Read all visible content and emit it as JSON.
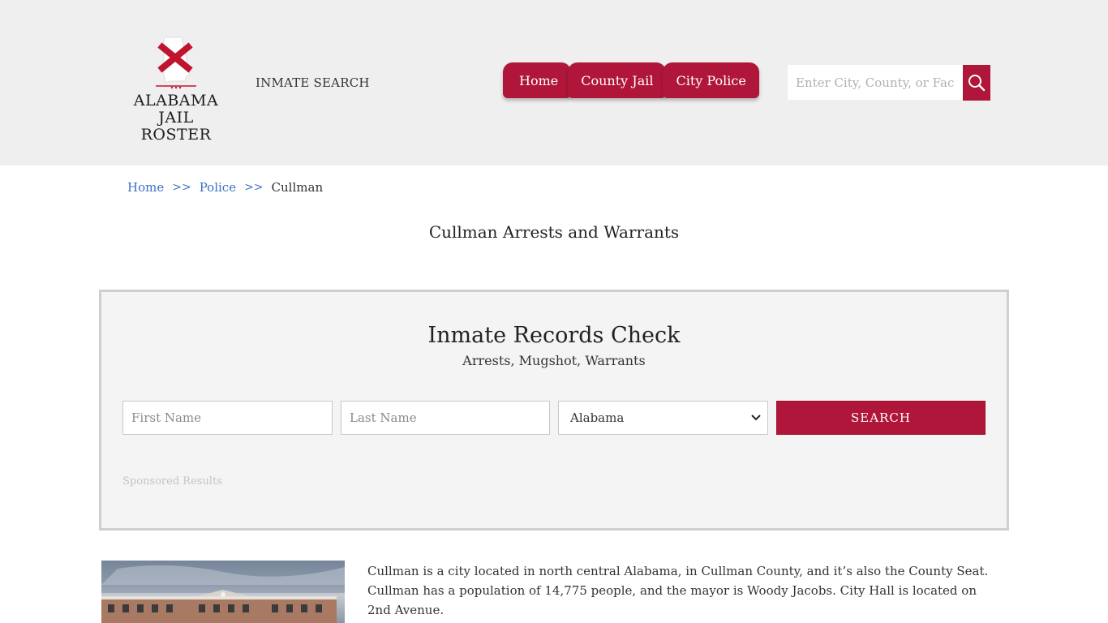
{
  "header": {
    "logo_text_line1": "ALABAMA",
    "logo_text_line2": "JAIL ROSTER",
    "inmate_search_link": "INMATE SEARCH",
    "nav": [
      {
        "label": "Home"
      },
      {
        "label": "County Jail"
      },
      {
        "label": "City Police"
      }
    ],
    "search_placeholder": "Enter City, County, or Facility",
    "search_icon": "magnifier-icon"
  },
  "breadcrumb": {
    "items": [
      "Home",
      "Police"
    ],
    "separator": ">>",
    "current": "Cullman"
  },
  "page_title": "Cullman Arrests and Warrants",
  "records_check": {
    "title": "Inmate Records Check",
    "subtitle": "Arrests, Mugshot, Warrants",
    "first_name_placeholder": "First Name",
    "last_name_placeholder": "Last Name",
    "state_selected": "Alabama",
    "search_button": "SEARCH",
    "sponsored": "Sponsored Results"
  },
  "description": "Cullman is a city located in north central Alabama, in Cullman County, and it’s also the County Seat. Cullman has a population of 14,775 people, and the mayor is Woody Jacobs. City Hall is located on 2nd Avenue.",
  "colors": {
    "brand": "#b01639",
    "header_bg": "#efefef",
    "link": "#3a6fc4",
    "panel_bg": "#f4f4f4"
  }
}
